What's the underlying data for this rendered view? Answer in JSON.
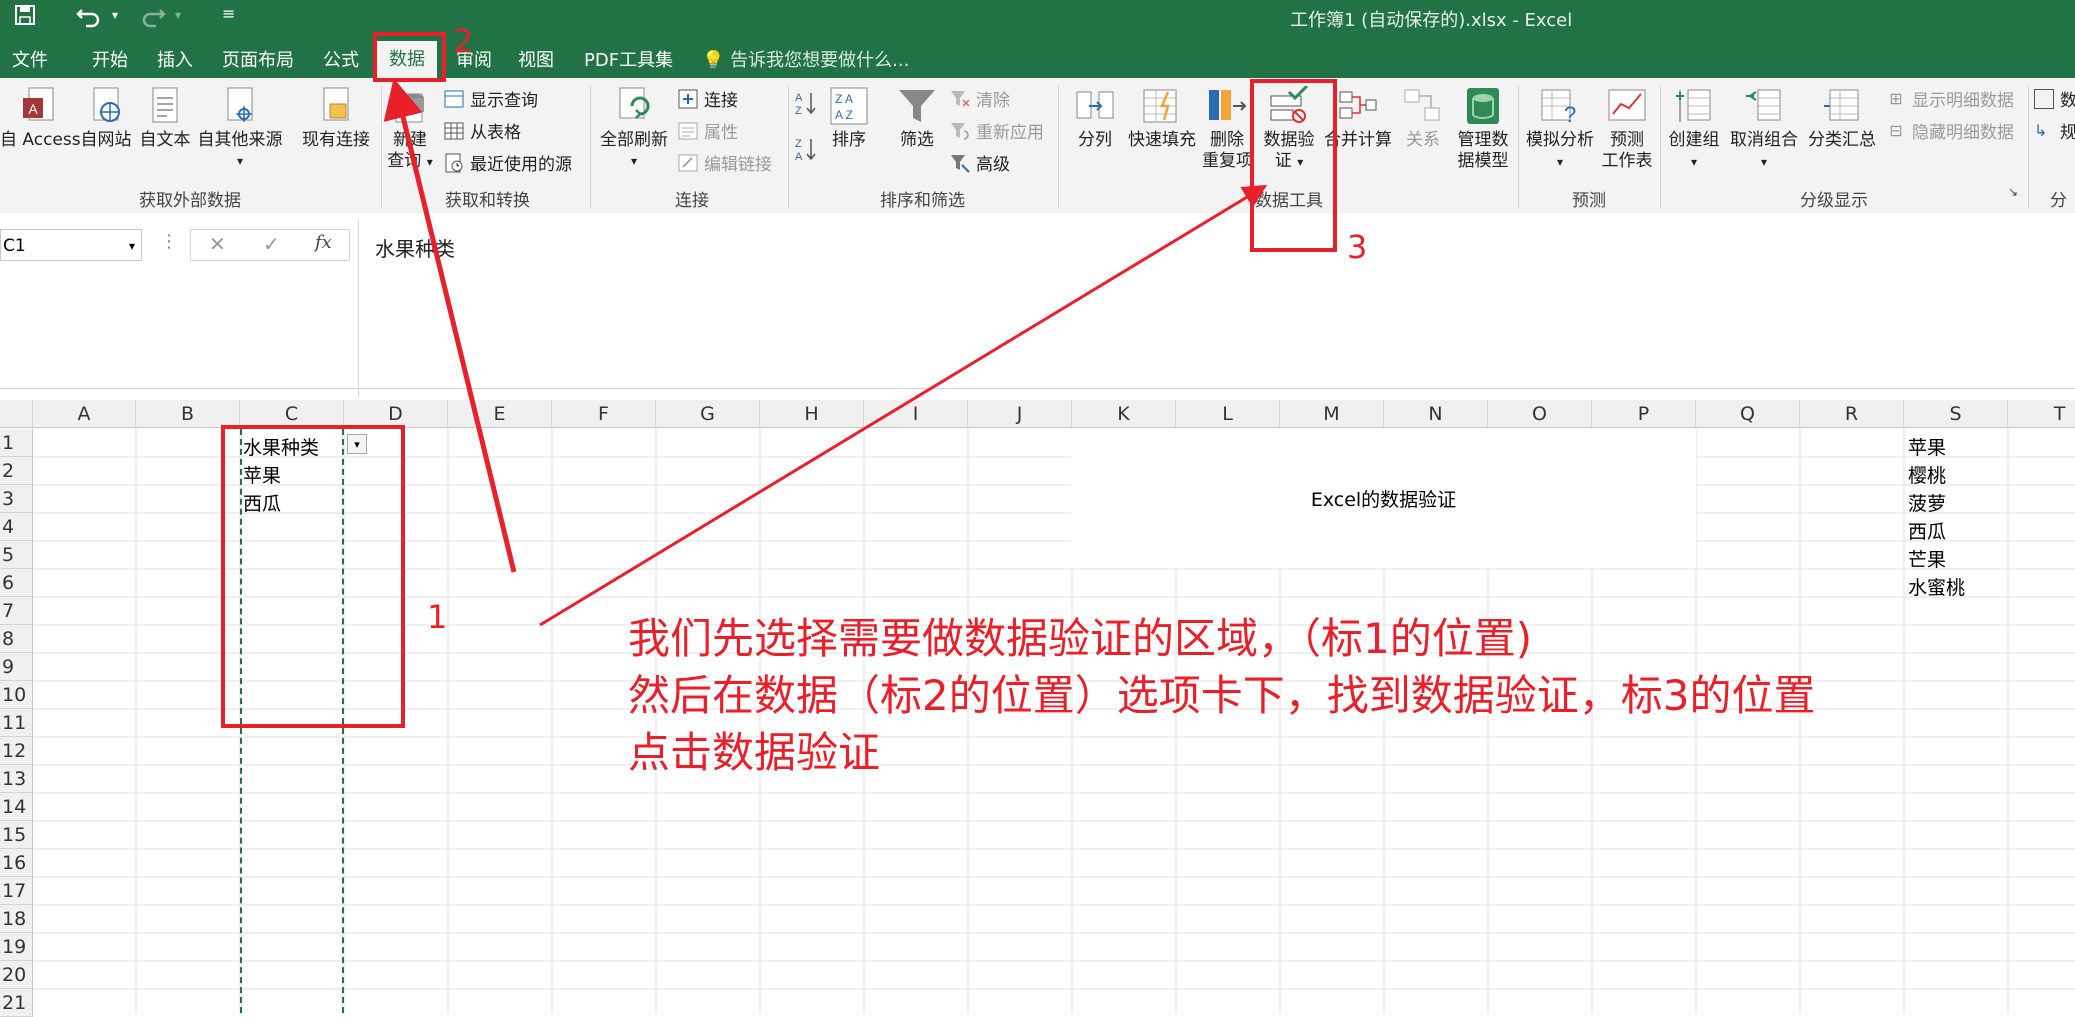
{
  "window": {
    "title": "工作簿1 (自动保存的).xlsx - Excel",
    "brand_color": "#217346",
    "annotation_color": "#e8202a"
  },
  "tabs": [
    "文件",
    "开始",
    "插入",
    "页面布局",
    "公式",
    "数据",
    "审阅",
    "视图",
    "PDF工具集"
  ],
  "active_tab": "数据",
  "tell_me": "告诉我您想要做什么...",
  "ribbon": {
    "get_external": {
      "from_access": "自 Access",
      "from_web": "自网站",
      "from_text": "自文本",
      "from_other": "自其他来源",
      "existing": "现有连接",
      "group": "获取外部数据"
    },
    "get_transform": {
      "new_query_1": "新建",
      "new_query_2": "查询",
      "show_queries": "显示查询",
      "from_table": "从表格",
      "recent_sources": "最近使用的源",
      "group": "获取和转换"
    },
    "connections": {
      "refresh_all": "全部刷新",
      "connections": "连接",
      "properties": "属性",
      "edit_links": "编辑链接",
      "group": "连接"
    },
    "sort_filter": {
      "sort": "排序",
      "filter": "筛选",
      "clear": "清除",
      "reapply": "重新应用",
      "advanced": "高级",
      "group": "排序和筛选"
    },
    "data_tools": {
      "text_to_columns": "分列",
      "flash_fill": "快速填充",
      "remove_dup_1": "删除",
      "remove_dup_2": "重复项",
      "data_val_1": "数据验",
      "data_val_2": "证",
      "consolidate": "合并计算",
      "relationships": "关系",
      "manage_model_1": "管理数",
      "manage_model_2": "据模型",
      "group": "数据工具"
    },
    "forecast": {
      "what_if": "模拟分析",
      "forecast_1": "预测",
      "forecast_2": "工作表",
      "group": "预测"
    },
    "outline": {
      "group_btn": "创建组",
      "ungroup": "取消组合",
      "subtotal": "分类汇总",
      "show_detail": "显示明细数据",
      "hide_detail": "隐藏明细数据",
      "group": "分级显示"
    },
    "extra": {
      "a": "数",
      "b": "规",
      "c": "分"
    }
  },
  "formula_bar": {
    "name_box": "C1",
    "cancel": "✕",
    "enter": "✓",
    "fx": "fx",
    "content": "水果种类"
  },
  "grid": {
    "columns": [
      "A",
      "B",
      "C",
      "D",
      "E",
      "F",
      "G",
      "H",
      "I",
      "J",
      "K",
      "L",
      "M",
      "N",
      "O",
      "P",
      "Q",
      "R",
      "S",
      "T"
    ],
    "rows": [
      "1",
      "2",
      "3",
      "4",
      "5",
      "6",
      "7",
      "8",
      "9",
      "10",
      "11",
      "12",
      "13",
      "14",
      "15",
      "16",
      "17",
      "18",
      "19",
      "20",
      "21"
    ],
    "cells": {
      "C1": "水果种类",
      "C2": "苹果",
      "C3": "西瓜",
      "merged_K1_P5": "Excel的数据验证",
      "S1": "苹果",
      "S2": "樱桃",
      "S3": "菠萝",
      "S4": "西瓜",
      "S5": "芒果",
      "S6": "水蜜桃"
    }
  },
  "annotations": {
    "n1": "1",
    "n2": "2",
    "n3": "3",
    "line1": "我们先选择需要做数据验证的区域，（标1的位置)",
    "line2": "然后在数据（标2的位置）选项卡下，找到数据验证，标3的位置",
    "line3": "点击数据验证"
  }
}
